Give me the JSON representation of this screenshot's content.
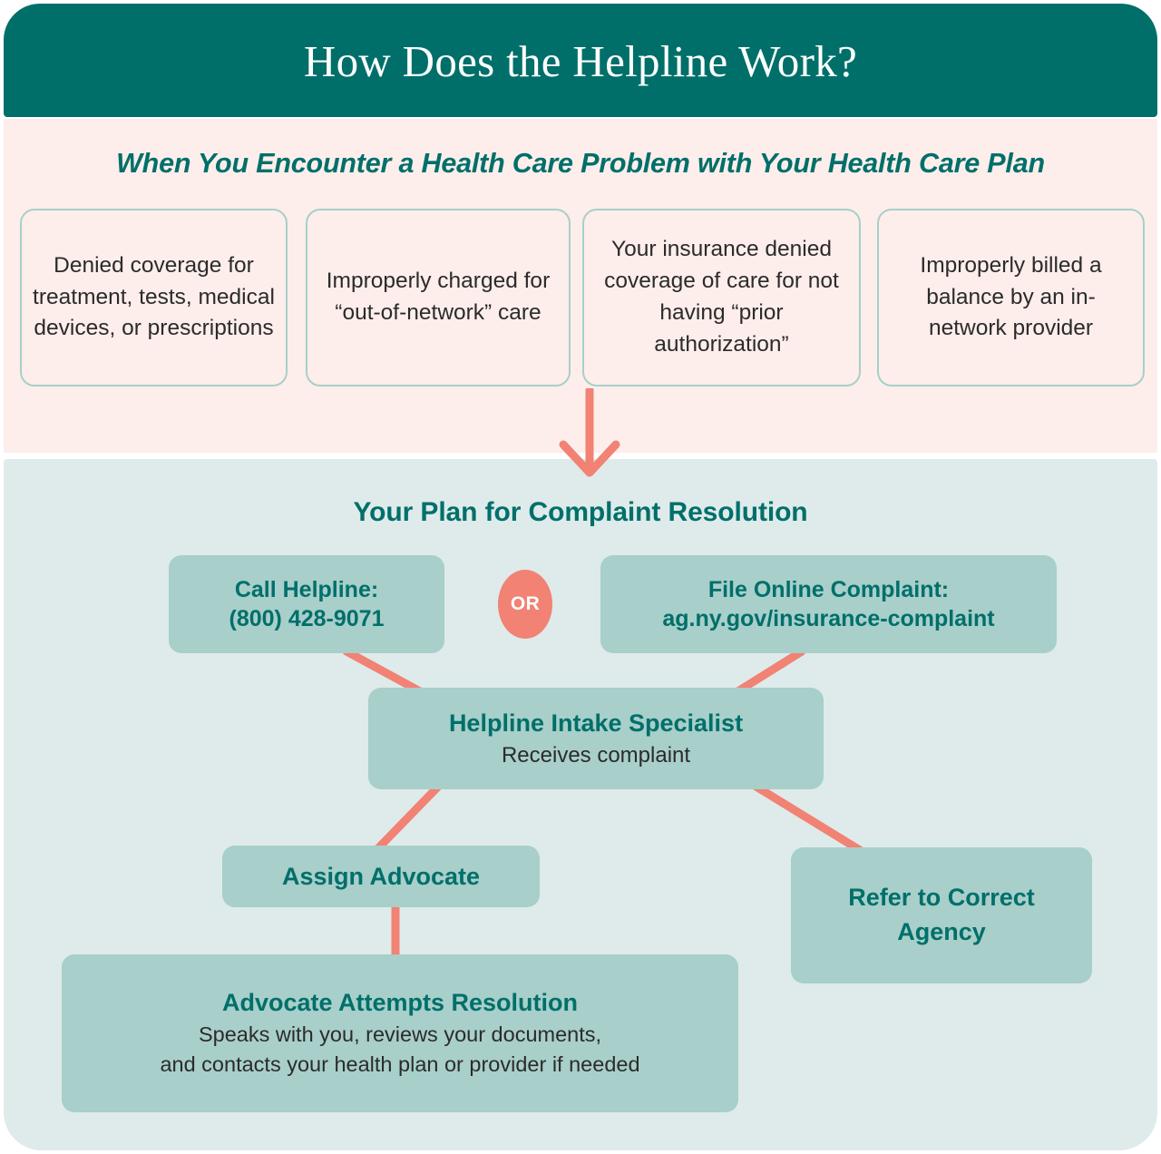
{
  "header": {
    "title": "How Does the Helpline Work?"
  },
  "problems": {
    "heading": "When You Encounter a Health Care Problem with Your Health Care Plan",
    "boxes": [
      {
        "text": "Denied coverage for treatment, tests, medical devices, or prescriptions"
      },
      {
        "text": "Improperly charged for “out-of-network” care"
      },
      {
        "text": "Your insurance denied coverage of care for not having “prior authorization”"
      },
      {
        "text": "Improperly billed a balance by an in-network provider"
      }
    ]
  },
  "plan": {
    "heading": "Your Plan for Complaint Resolution",
    "or_label": "OR",
    "nodes": {
      "call": {
        "title": "Call Helpline:",
        "sub": "(800) 428-9071"
      },
      "file": {
        "title": "File Online Complaint:",
        "sub": "ag.ny.gov/insurance-complaint"
      },
      "intake": {
        "title": "Helpline Intake Specialist",
        "sub": "Receives complaint"
      },
      "assign": {
        "title": "Assign Advocate"
      },
      "refer": {
        "title": "Refer to Correct Agency"
      },
      "advocate": {
        "title": "Advocate Attempts Resolution",
        "sub1": "Speaks with you, reviews your documents,",
        "sub2": "and contacts your health plan or provider if needed"
      }
    }
  },
  "colors": {
    "header_teal": "#006F6A",
    "pink_bg": "#FDEEEB",
    "teal_bg": "#DEEBEA",
    "node_fill": "#A8CFCA",
    "accent_coral": "#F18274",
    "text_dark": "#2B2B2B"
  }
}
